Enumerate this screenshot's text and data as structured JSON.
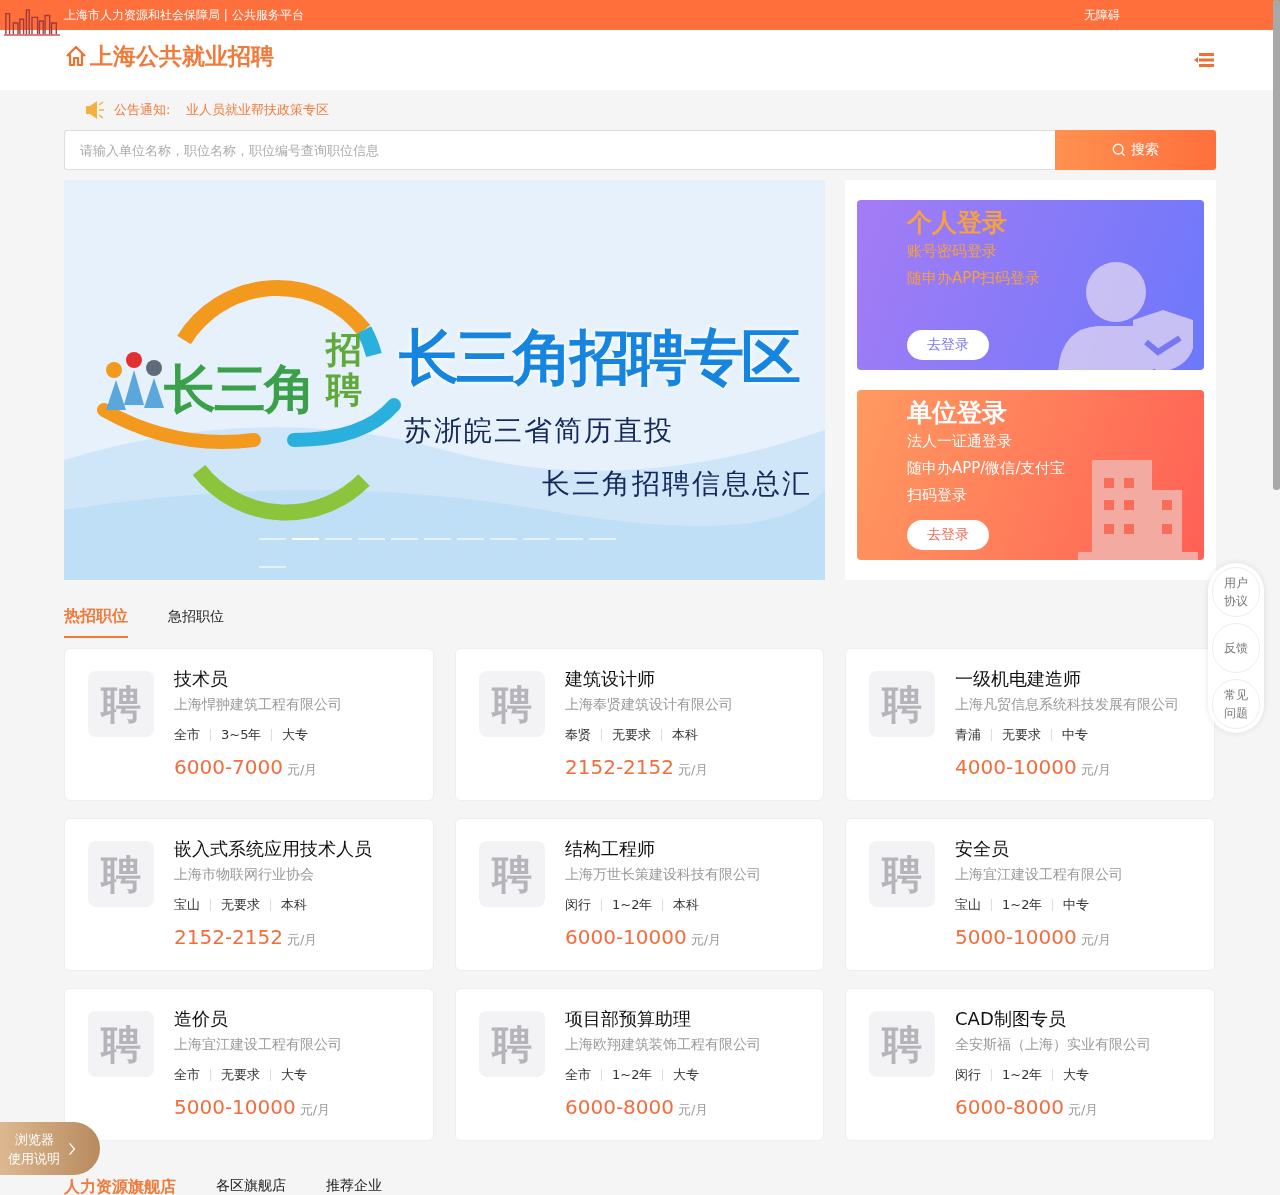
{
  "topbar": {
    "title": "上海市人力资源和社会保障局 | 公共服务平台",
    "accessibility": "无障碍"
  },
  "header": {
    "brand": "上海公共就业招聘"
  },
  "notice": {
    "label": "公告通知:",
    "text": "业人员就业帮扶政策专区"
  },
  "search": {
    "placeholder": "请输入单位名称，职位名称，职位编号查询职位信息",
    "button": "搜索"
  },
  "banner": {
    "logo_text": "长三角",
    "logo_side": "招聘",
    "headline": "长三角招聘专区",
    "line_1": "苏浙皖三省简历直投",
    "line_2": "长三角招聘信息总汇",
    "slides": [
      {
        "selected": false
      },
      {
        "selected": true
      },
      {
        "selected": false
      },
      {
        "selected": false
      },
      {
        "selected": false
      },
      {
        "selected": false
      },
      {
        "selected": false
      },
      {
        "selected": false
      },
      {
        "selected": false
      },
      {
        "selected": false
      },
      {
        "selected": false
      },
      {
        "selected": false
      }
    ]
  },
  "logins": [
    {
      "kind": "personal",
      "title": "个人登录",
      "lines": [
        "账号密码登录",
        "随申办APP扫码登录"
      ],
      "button": "去登录"
    },
    {
      "kind": "company",
      "title": "单位登录",
      "lines": [
        "法人一证通登录",
        "随申办APP/微信/支付宝",
        "扫码登录"
      ],
      "button": "去登录"
    }
  ],
  "job_tabs": [
    {
      "label": "热招职位",
      "selected": true
    },
    {
      "label": "急招职位",
      "selected": false
    }
  ],
  "jobs": [
    {
      "logo": "聘",
      "title": "技术员",
      "company": "上海悍翀建筑工程有限公司",
      "tags": [
        "全市",
        "3~5年",
        "大专"
      ],
      "salary": "6000-7000",
      "unit": "元/月"
    },
    {
      "logo": "聘",
      "title": "建筑设计师",
      "company": "上海奉贤建筑设计有限公司",
      "tags": [
        "奉贤",
        "无要求",
        "本科"
      ],
      "salary": "2152-2152",
      "unit": "元/月"
    },
    {
      "logo": "聘",
      "title": "一级机电建造师",
      "company": "上海凡贸信息系统科技发展有限公司",
      "tags": [
        "青浦",
        "无要求",
        "中专"
      ],
      "salary": "4000-10000",
      "unit": "元/月"
    },
    {
      "logo": "聘",
      "title": "嵌入式系统应用技术人员",
      "company": "上海市物联网行业协会",
      "tags": [
        "宝山",
        "无要求",
        "本科"
      ],
      "salary": "2152-2152",
      "unit": "元/月"
    },
    {
      "logo": "聘",
      "title": "结构工程师",
      "company": "上海万世长策建设科技有限公司",
      "tags": [
        "闵行",
        "1~2年",
        "本科"
      ],
      "salary": "6000-10000",
      "unit": "元/月"
    },
    {
      "logo": "聘",
      "title": "安全员",
      "company": "上海宜江建设工程有限公司",
      "tags": [
        "宝山",
        "1~2年",
        "中专"
      ],
      "salary": "5000-10000",
      "unit": "元/月"
    },
    {
      "logo": "聘",
      "title": "造价员",
      "company": "上海宜江建设工程有限公司",
      "tags": [
        "全市",
        "无要求",
        "大专"
      ],
      "salary": "5000-10000",
      "unit": "元/月"
    },
    {
      "logo": "聘",
      "title": "项目部预算助理",
      "company": "上海欧翔建筑装饰工程有限公司",
      "tags": [
        "全市",
        "1~2年",
        "大专"
      ],
      "salary": "6000-8000",
      "unit": "元/月"
    },
    {
      "logo": "聘",
      "title": "CAD制图专员",
      "company": "全安斯福（上海）实业有限公司",
      "tags": [
        "闵行",
        "1~2年",
        "大专"
      ],
      "salary": "6000-8000",
      "unit": "元/月"
    }
  ],
  "store_tabs": [
    {
      "label": "人力资源旗舰店",
      "selected": true
    },
    {
      "label": "各区旗舰店",
      "selected": false
    },
    {
      "label": "推荐企业",
      "selected": false
    }
  ],
  "side_buttons": [
    {
      "lines": [
        "用户",
        "协议"
      ]
    },
    {
      "lines": [
        "反馈"
      ]
    },
    {
      "lines": [
        "常见",
        "问题"
      ]
    }
  ],
  "browser_tip": {
    "lines": [
      "浏览器",
      "使用说明"
    ]
  }
}
